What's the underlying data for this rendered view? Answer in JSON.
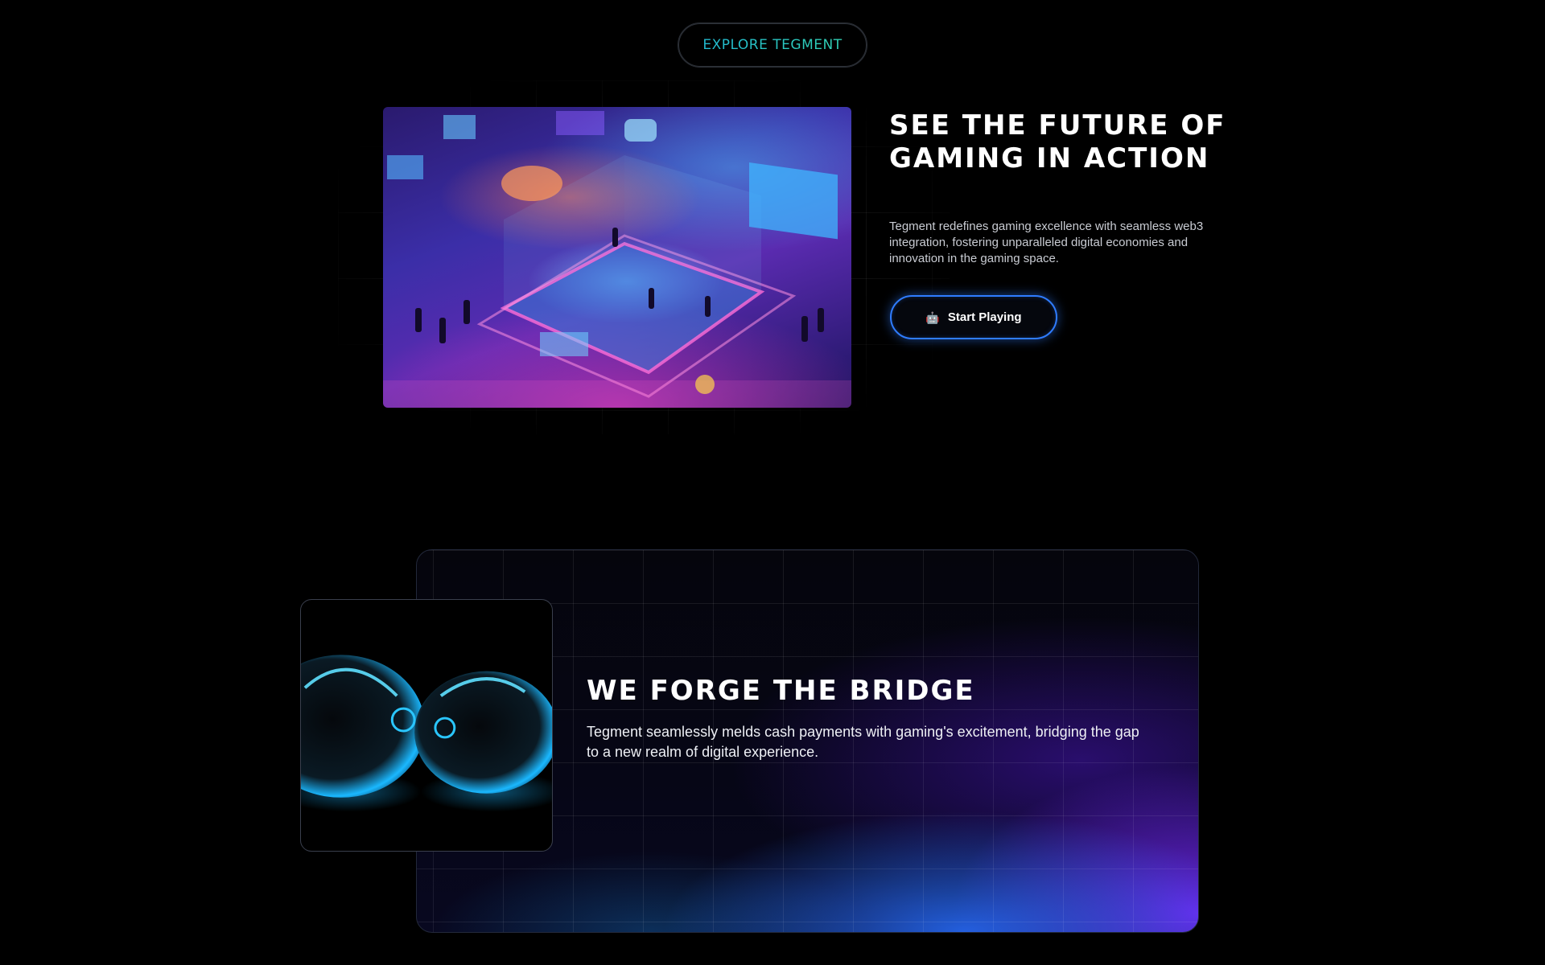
{
  "explore": {
    "label": "EXPLORE TEGMENT"
  },
  "hero": {
    "title": "SEE THE FUTURE OF GAMING IN ACTION",
    "description": "Tegment redefines gaming excellence with seamless web3 integration, fostering unparalleled digital economies and innovation in the gaming space.",
    "cta": {
      "label": "Start Playing",
      "icon": "robot-icon"
    }
  },
  "bridge": {
    "title": "WE FORGE THE BRIDGE",
    "description": "Tegment seamlessly melds cash payments with gaming's excitement, bridging the gap to a new realm of digital experience."
  },
  "colors": {
    "background": "#000000",
    "accent_teal": "#1fb6d6",
    "accent_blue": "#2f7cff",
    "accent_purple": "#7828ff"
  }
}
